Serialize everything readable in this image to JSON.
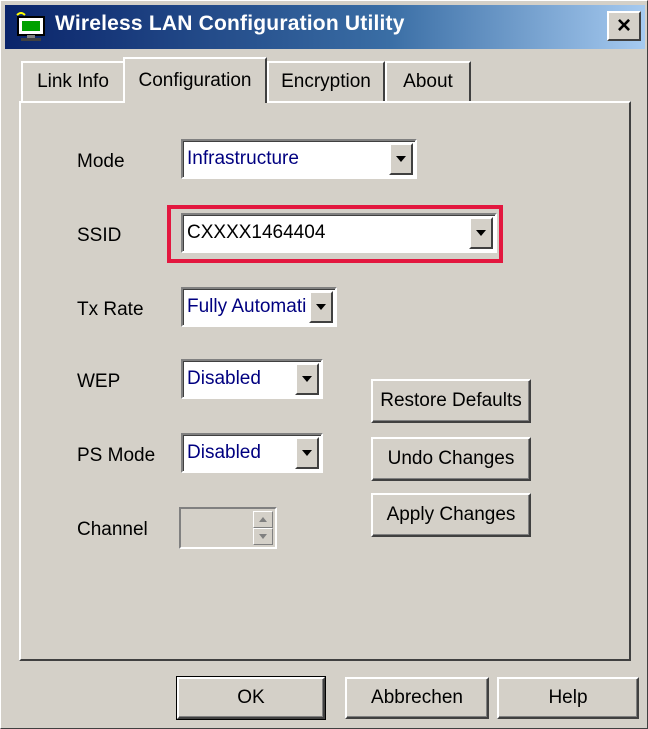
{
  "window": {
    "title": "Wireless LAN Configuration Utility",
    "close_glyph": "×"
  },
  "tabs": [
    {
      "label": "Link Info"
    },
    {
      "label": "Configuration",
      "active": true
    },
    {
      "label": "Encryption"
    },
    {
      "label": "About"
    }
  ],
  "fields": {
    "mode": {
      "label": "Mode",
      "value": "Infrastructure"
    },
    "ssid": {
      "label": "SSID",
      "value": "CXXXX1464404"
    },
    "tx_rate": {
      "label": "Tx Rate",
      "value": "Fully Automatic"
    },
    "wep": {
      "label": "WEP",
      "value": "Disabled"
    },
    "ps_mode": {
      "label": "PS Mode",
      "value": "Disabled"
    },
    "channel": {
      "label": "Channel",
      "value": ""
    }
  },
  "side_buttons": {
    "restore": "Restore Defaults",
    "undo": "Undo Changes",
    "apply": "Apply Changes"
  },
  "footer_buttons": {
    "ok": "OK",
    "cancel": "Abbrechen",
    "help": "Help"
  },
  "colors": {
    "highlight": "#e3173f",
    "value_text": "#000080"
  }
}
